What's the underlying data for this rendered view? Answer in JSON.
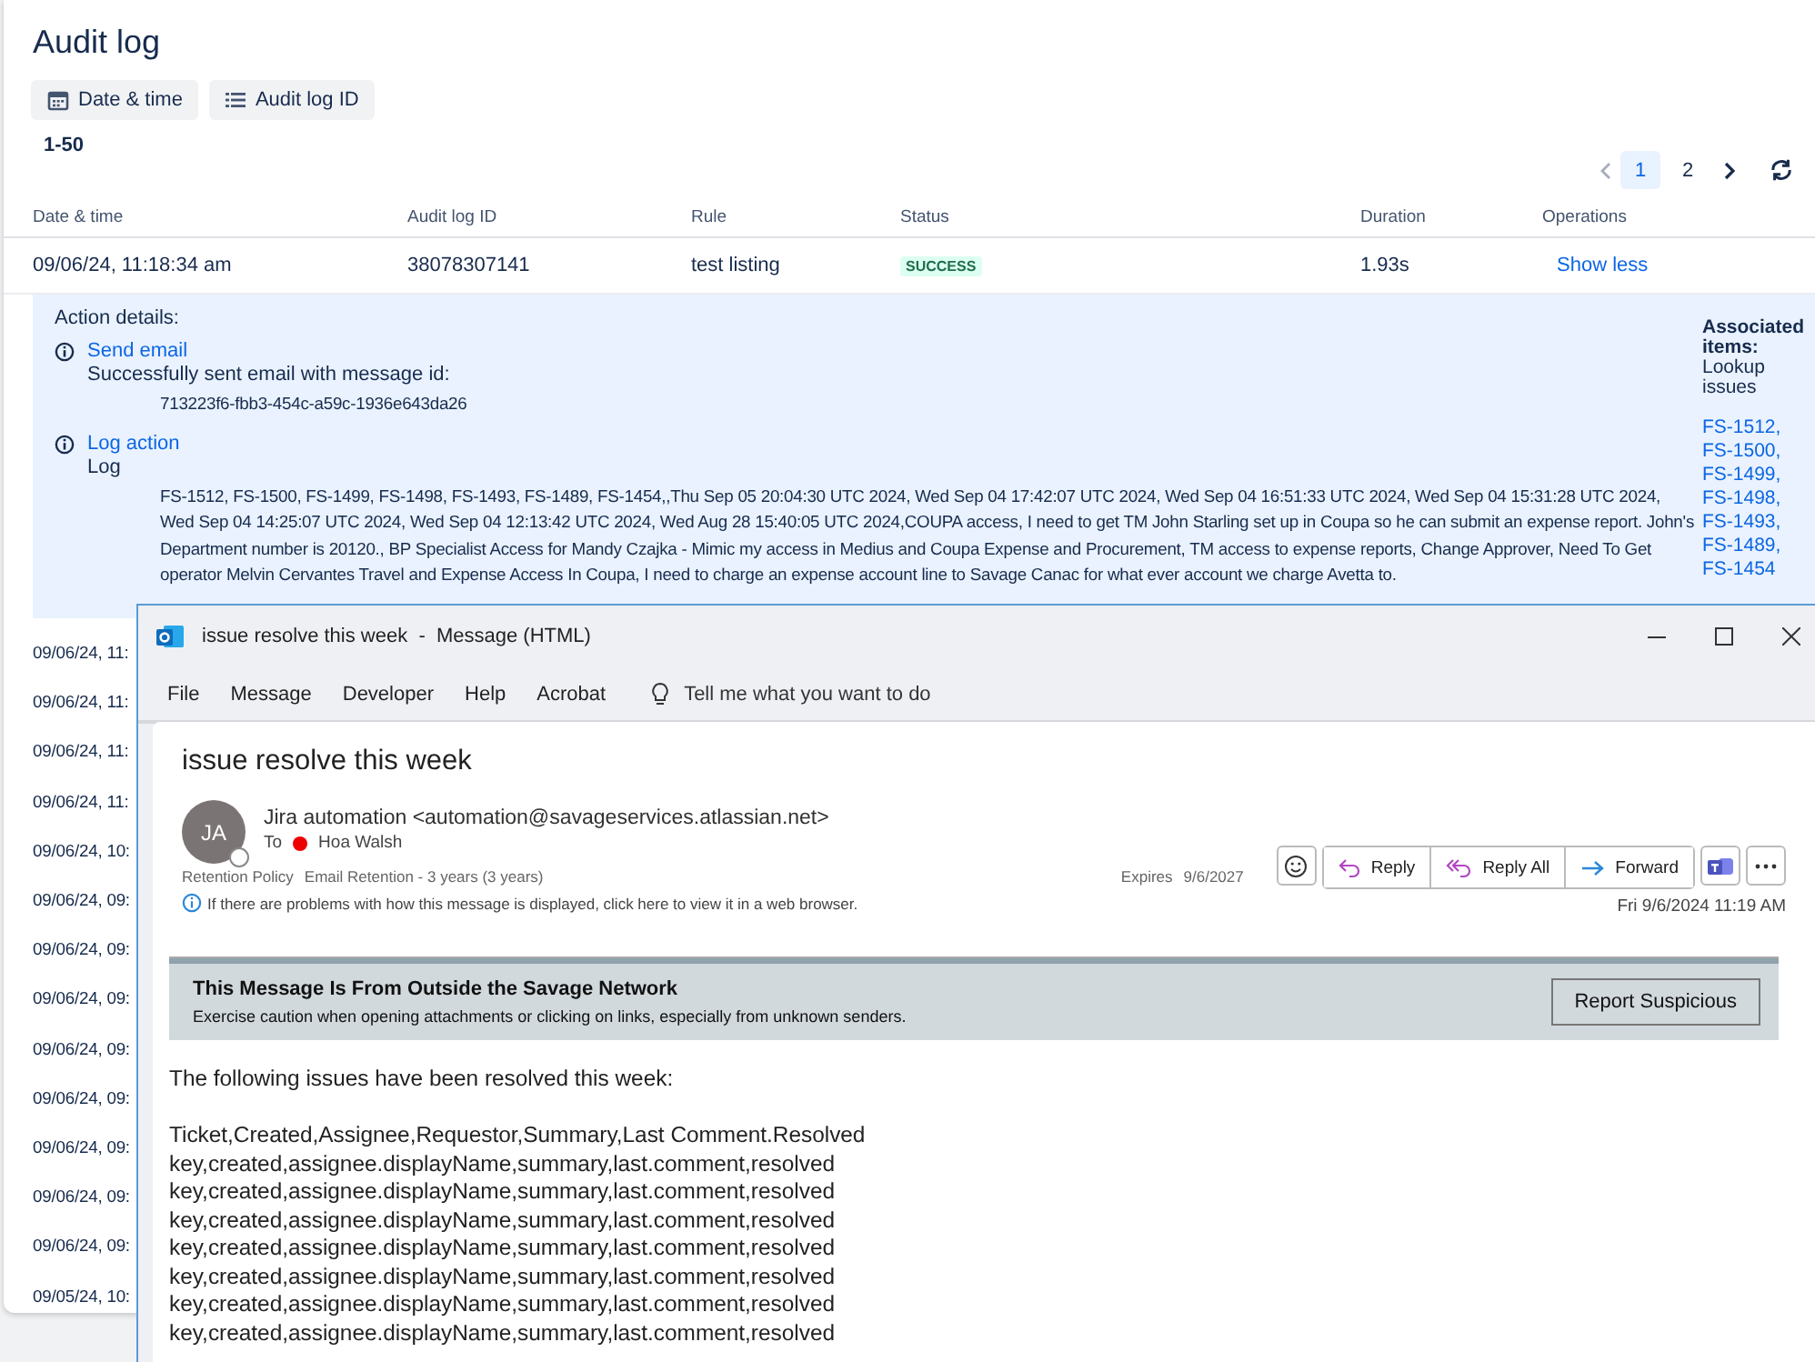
{
  "audit_log": {
    "title": "Audit log",
    "filters": [
      {
        "kind": "calendar",
        "label": "Date & time"
      },
      {
        "kind": "list",
        "label": "Audit log ID"
      }
    ],
    "range": "1-50",
    "pages": [
      {
        "label": "1",
        "selected": true
      },
      {
        "label": "2",
        "selected": false
      }
    ],
    "columns": [
      "Date & time",
      "Audit log ID",
      "Rule",
      "Status",
      "Duration",
      "Operations"
    ],
    "expanded_row": {
      "date": "09/06/24, 11:18:34 am",
      "id": "38078307141",
      "rule": "test listing",
      "status": "SUCCESS",
      "duration": "1.93s",
      "operation": "Show less"
    },
    "action_details": {
      "title": "Action details:",
      "actions": [
        {
          "name": "Send email",
          "description": "Successfully sent email with message id:",
          "detail": "713223f6-fbb3-454c-a59c-1936e643da26"
        },
        {
          "name": "Log action",
          "description": "Log",
          "detail": "FS-1512, FS-1500, FS-1499, FS-1498, FS-1493, FS-1489, FS-1454,,Thu Sep 05 20:04:30 UTC 2024, Wed Sep 04 17:42:07 UTC 2024, Wed Sep 04 16:51:33 UTC 2024, Wed Sep 04 15:31:28 UTC 2024, Wed Sep 04 14:25:07 UTC 2024, Wed Sep 04 12:13:42 UTC 2024, Wed Aug 28 15:40:05 UTC 2024,COUPA access, I need to get TM John Starling set up in Coupa so he can submit an expense report. John's Department number is 20120., BP Specialist Access for Mandy Czajka - Mimic my access in Medius and Coupa Expense and Procurement, TM access to expense reports, Change Approver, Need To Get operator Melvin Cervantes Travel and Expense Access In Coupa, I need to charge an expense account line to Savage Canac for what ever account we charge Avetta to."
        }
      ],
      "associated_title": "Associated items:",
      "associated_subtitle": "Lookup issues",
      "issues": [
        "FS-1512,",
        "FS-1500,",
        "FS-1499,",
        "FS-1498,",
        "FS-1493,",
        "FS-1489,",
        "FS-1454"
      ]
    },
    "rows": [
      "09/06/24, 11:",
      "09/06/24, 11:",
      "09/06/24, 11:",
      "09/06/24, 11:",
      "09/06/24, 10:",
      "09/06/24, 09:",
      "09/06/24, 09:",
      "09/06/24, 09:",
      "09/06/24, 09:",
      "09/06/24, 09:",
      "09/06/24, 09:",
      "09/06/24, 09:",
      "09/06/24, 09:",
      "09/05/24, 10:"
    ]
  },
  "outlook": {
    "window_title": "issue resolve this week  -  Message (HTML)",
    "menu": [
      "File",
      "Message",
      "Developer",
      "Help",
      "Acrobat"
    ],
    "tell_me": {
      "placeholder": "Tell me what you want to do"
    },
    "subject": "issue resolve this week",
    "avatar": "JA",
    "sender": "Jira automation <automation@savageservices.atlassian.net>",
    "to_label": "To",
    "recipient": "Hoa Walsh",
    "actions": [
      {
        "kind": "reply",
        "label": "Reply"
      },
      {
        "kind": "reply_all",
        "label": "Reply All"
      },
      {
        "kind": "forward",
        "label": "Forward"
      }
    ],
    "received": "Fri 9/6/2024 11:19 AM",
    "retention_label": "Retention Policy",
    "retention_value": "Email Retention - 3 years (3 years)",
    "expires_label": "Expires",
    "expires_value": "9/6/2027",
    "info": "If there are problems with how this message is displayed, click here to view it in a web browser.",
    "banner": {
      "title": "This Message Is From Outside the Savage Network",
      "text": "Exercise caution when opening attachments or clicking on links, especially from unknown senders.",
      "button": "Report Suspicious"
    },
    "body": {
      "intro": "The following issues have been resolved this week:",
      "lines": [
        "Ticket,Created,Assignee,Requestor,Summary,Last Comment.Resolved",
        "key,created,assignee.displayName,summary,last.comment,resolved",
        "key,created,assignee.displayName,summary,last.comment,resolved",
        "key,created,assignee.displayName,summary,last.comment,resolved",
        "key,created,assignee.displayName,summary,last.comment,resolved",
        "key,created,assignee.displayName,summary,last.comment,resolved",
        "key,created,assignee.displayName,summary,last.comment,resolved",
        "key,created,assignee.displayName,summary,last.comment,resolved"
      ]
    }
  }
}
